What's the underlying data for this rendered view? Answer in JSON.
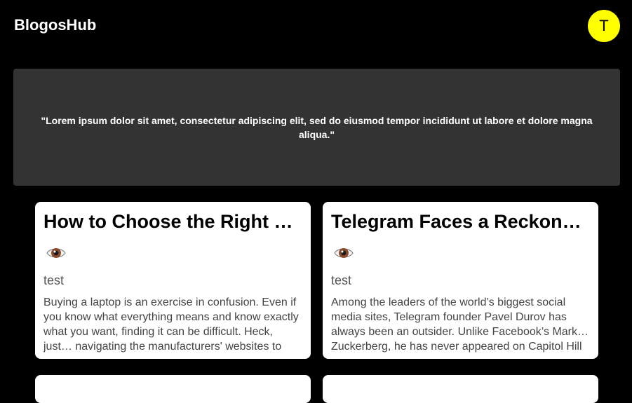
{
  "header": {
    "brand": "BlogosHub",
    "avatar_initial": "T"
  },
  "banner": {
    "quote": "\"Lorem ipsum dolor sit amet, consectetur adipiscing elit, sed do eiusmod tempor incididunt ut labore et dolore magna aliqua.\""
  },
  "posts": [
    {
      "title": "How to Choose the Right Laptop",
      "icon": "eye-icon",
      "tag": "test",
      "excerpt": "Buying a laptop is an exercise in confusion. Even if you know what everything means and know exactly what you want, finding it can be difficult. Heck, just… navigating the manufacturers' websites to locate the"
    },
    {
      "title": "Telegram Faces a Reckoning",
      "icon": "eye-icon",
      "tag": "test",
      "excerpt": "Among the leaders of the world’s biggest social media sites, Telegram founder Pavel Durov has always been an outsider. Unlike Facebook’s Mark… Zuckerberg, he has never appeared on Capitol Hill to"
    }
  ]
}
